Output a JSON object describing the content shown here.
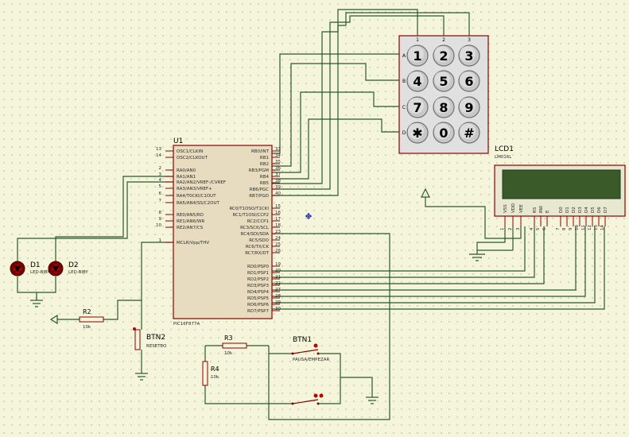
{
  "mcu": {
    "ref": "U1",
    "part": "PIC16F877A",
    "left_pins": [
      {
        "num": "13",
        "name": "OSC1/CLKIN"
      },
      {
        "num": "14",
        "name": "OSC2/CLKOUT"
      },
      {
        "num": "2",
        "name": "RA0/AN0"
      },
      {
        "num": "3",
        "name": "RA1/AN1"
      },
      {
        "num": "4",
        "name": "RA2/AN2/VREF-/CVREF"
      },
      {
        "num": "5",
        "name": "RA3/AN3/VREF+"
      },
      {
        "num": "6",
        "name": "RA4/T0CKI/C1OUT"
      },
      {
        "num": "7",
        "name": "RA5/AN4/SS/C2OUT"
      },
      {
        "num": "8",
        "name": "RE0/AN5/RD"
      },
      {
        "num": "9",
        "name": "RE1/AN6/WR"
      },
      {
        "num": "10",
        "name": "RE2/AN7/CS"
      },
      {
        "num": "1",
        "name": "MCLR/Vpp/THV"
      }
    ],
    "right_pins": [
      {
        "num": "33",
        "name": "RB0/INT"
      },
      {
        "num": "34",
        "name": "RB1"
      },
      {
        "num": "35",
        "name": "RB2"
      },
      {
        "num": "36",
        "name": "RB3/PGM"
      },
      {
        "num": "37",
        "name": "RB4"
      },
      {
        "num": "38",
        "name": "RB5"
      },
      {
        "num": "39",
        "name": "RB6/PGC"
      },
      {
        "num": "40",
        "name": "RB7/PGD"
      },
      {
        "num": "15",
        "name": "RC0/T1OSO/T1CKI"
      },
      {
        "num": "16",
        "name": "RC1/T1OSI/CCP2"
      },
      {
        "num": "17",
        "name": "RC2/CCP1"
      },
      {
        "num": "18",
        "name": "RC3/SCK/SCL"
      },
      {
        "num": "23",
        "name": "RC4/SDI/SDA"
      },
      {
        "num": "24",
        "name": "RC5/SDO"
      },
      {
        "num": "25",
        "name": "RC6/TX/CK"
      },
      {
        "num": "26",
        "name": "RC7/RX/DT"
      },
      {
        "num": "19",
        "name": "RD0/PSP0"
      },
      {
        "num": "20",
        "name": "RD1/PSP1"
      },
      {
        "num": "21",
        "name": "RD2/PSP2"
      },
      {
        "num": "22",
        "name": "RD3/PSP3"
      },
      {
        "num": "27",
        "name": "RD4/PSP4"
      },
      {
        "num": "28",
        "name": "RD5/PSP5"
      },
      {
        "num": "29",
        "name": "RD6/PSP6"
      },
      {
        "num": "30",
        "name": "RD7/PSP7"
      }
    ]
  },
  "keypad": {
    "keys": [
      "1",
      "2",
      "3",
      "4",
      "5",
      "6",
      "7",
      "8",
      "9",
      "✱",
      "0",
      "#"
    ],
    "rows": [
      "A",
      "B",
      "C",
      "D"
    ],
    "cols": [
      "1",
      "2",
      "3"
    ]
  },
  "lcd": {
    "ref": "LCD1",
    "part": "LM016L",
    "pins": [
      {
        "name": "VSS",
        "num": "1"
      },
      {
        "name": "VDD",
        "num": "2"
      },
      {
        "name": "VEE",
        "num": "3"
      },
      {
        "name": "RS",
        "num": "4"
      },
      {
        "name": "RW",
        "num": "5"
      },
      {
        "name": "E",
        "num": "6"
      },
      {
        "name": "D0",
        "num": "7"
      },
      {
        "name": "D1",
        "num": "8"
      },
      {
        "name": "D2",
        "num": "9"
      },
      {
        "name": "D3",
        "num": "10"
      },
      {
        "name": "D4",
        "num": "11"
      },
      {
        "name": "D5",
        "num": "12"
      },
      {
        "name": "D6",
        "num": "13"
      },
      {
        "name": "D7",
        "num": "14"
      }
    ]
  },
  "leds": [
    {
      "ref": "D1",
      "part": "LED-BIBY"
    },
    {
      "ref": "D2",
      "part": "LED-BIBY"
    }
  ],
  "resistors": [
    {
      "ref": "R2",
      "value": "10k"
    },
    {
      "ref": "R3",
      "value": "10k"
    },
    {
      "ref": "R4",
      "value": "10k"
    }
  ],
  "buttons": [
    {
      "ref": "BTN2",
      "part": "RESETEO"
    },
    {
      "ref": "BTN1",
      "part": "PAUSA/EMPEZAR"
    }
  ]
}
